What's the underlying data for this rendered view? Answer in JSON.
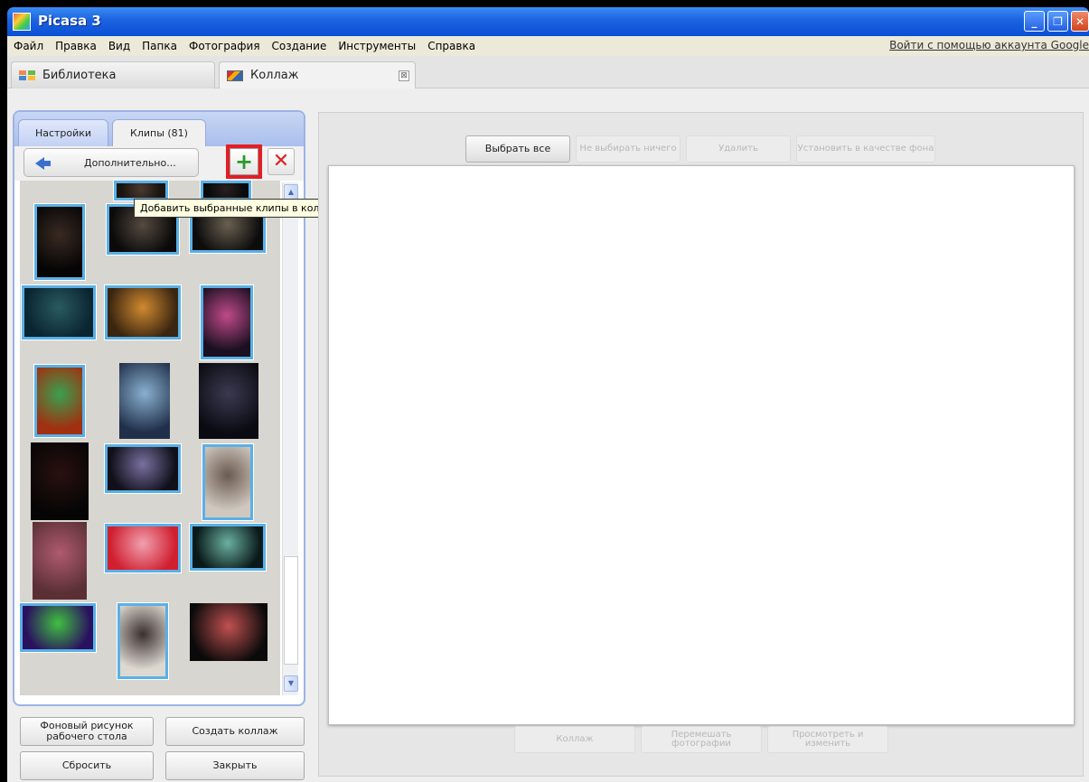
{
  "window": {
    "title": "Picasa 3",
    "minimize": "_",
    "restore": "❐",
    "close": "✕"
  },
  "menu": {
    "items": [
      "Файл",
      "Правка",
      "Вид",
      "Папка",
      "Фотография",
      "Создание",
      "Инструменты",
      "Справка"
    ],
    "sign_in": "Войти с помощью аккаунта Google"
  },
  "doc_tabs": {
    "library": "Библиотека",
    "collage": "Коллаж",
    "close_glyph": "⊠"
  },
  "left_panel": {
    "tabs": {
      "settings": "Настройки",
      "clips": "Клипы (81)"
    },
    "more_button": "Дополнительно...",
    "add_glyph": "+",
    "remove_glyph": "✕",
    "tooltip": "Добавить выбранные клипы в коллаж",
    "scroll_up": "▲",
    "scroll_down": "▼",
    "bottom_buttons": {
      "desktop_bg": "Фоновый рисунок рабочего стола",
      "create": "Создать коллаж",
      "reset": "Сбросить",
      "close": "Закрыть"
    }
  },
  "right_panel": {
    "top_buttons": {
      "select_all": "Выбрать все",
      "select_none": "Не выбирать ничего",
      "delete": "Удалить",
      "set_bg": "Установить в качестве фона"
    },
    "bottom_buttons": {
      "collage": "Коллаж",
      "shuffle": "Перемешать фотографии",
      "view_edit": "Просмотреть и изменить"
    }
  },
  "colors": {
    "highlight": "#e31e24",
    "selection_border": "#5ab0e6",
    "title_bar": "#0a4fd4"
  },
  "clips_grid": {
    "thumbnails": [
      {
        "name": "concert-photo",
        "selected": true,
        "palette": [
          "#1a1410",
          "#4a3a30"
        ]
      },
      {
        "name": "concert-photo",
        "selected": true,
        "palette": [
          "#0a0a0a",
          "#2a2020"
        ]
      },
      {
        "name": "concert-photo",
        "selected": true,
        "palette": [
          "#050505",
          "#3a2a22"
        ]
      },
      {
        "name": "concert-photo",
        "selected": true,
        "palette": [
          "#0a0a0a",
          "#554a40"
        ]
      },
      {
        "name": "concert-photo",
        "selected": true,
        "palette": [
          "#0c0c0c",
          "#6a6050"
        ]
      },
      {
        "name": "concert-photo",
        "selected": true,
        "palette": [
          "#0a2530",
          "#2a5a60"
        ]
      },
      {
        "name": "concert-photo",
        "selected": true,
        "palette": [
          "#3a2510",
          "#d08a30"
        ]
      },
      {
        "name": "concert-photo",
        "selected": true,
        "palette": [
          "#1a1020",
          "#c04a8a"
        ]
      },
      {
        "name": "concert-photo",
        "selected": true,
        "palette": [
          "#a03010",
          "#3aa050"
        ]
      },
      {
        "name": "concert-photo",
        "selected": false,
        "palette": [
          "#20304a",
          "#8ab0d0"
        ]
      },
      {
        "name": "concert-photo",
        "selected": false,
        "palette": [
          "#0a0a12",
          "#3a3a50"
        ]
      },
      {
        "name": "concert-photo",
        "selected": false,
        "palette": [
          "#050505",
          "#2a1010"
        ]
      },
      {
        "name": "concert-photo",
        "selected": true,
        "palette": [
          "#10101a",
          "#7a70a0"
        ]
      },
      {
        "name": "concert-photo",
        "selected": true,
        "palette": [
          "#d0c8c0",
          "#6a5a50"
        ]
      },
      {
        "name": "concert-photo",
        "selected": false,
        "palette": [
          "#5a3035",
          "#b05a70"
        ]
      },
      {
        "name": "concert-photo",
        "selected": true,
        "palette": [
          "#d02030",
          "#f0a0b0"
        ]
      },
      {
        "name": "concert-photo",
        "selected": true,
        "palette": [
          "#0a1a1a",
          "#6ab0a0"
        ]
      },
      {
        "name": "concert-photo",
        "selected": true,
        "palette": [
          "#2a1060",
          "#40c040"
        ]
      },
      {
        "name": "concert-photo",
        "selected": true,
        "palette": [
          "#ddd8d0",
          "#3a3030"
        ]
      },
      {
        "name": "concert-photo",
        "selected": false,
        "palette": [
          "#0a0a0a",
          "#c05050"
        ]
      }
    ]
  }
}
